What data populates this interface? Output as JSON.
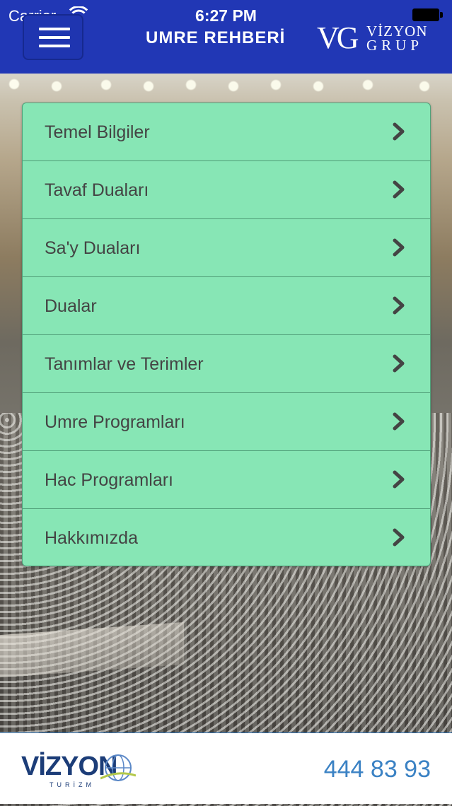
{
  "status_bar": {
    "carrier": "Carrier",
    "time": "6:27 PM"
  },
  "header": {
    "title": "UMRE REHBERİ",
    "brand_monogram": "VG",
    "brand_line1": "VİZYON",
    "brand_line2": "GRUP",
    "menu_icon": "hamburger-icon"
  },
  "menu": {
    "items": [
      {
        "label": "Temel Bilgiler"
      },
      {
        "label": "Tavaf Duaları"
      },
      {
        "label": "Sa'y Duaları"
      },
      {
        "label": "Dualar"
      },
      {
        "label": "Tanımlar ve Terimler"
      },
      {
        "label": "Umre Programları"
      },
      {
        "label": "Hac Programları"
      },
      {
        "label": "Hakkımızda"
      }
    ],
    "chevron_icon": "chevron-right-icon"
  },
  "footer": {
    "logo_text": "VİZYON",
    "logo_sub": "TURİZM",
    "phone": "444 83 93"
  },
  "colors": {
    "header_bg": "#2137b5",
    "menu_bg": "#87e6b5",
    "phone_color": "#3b82c4"
  }
}
